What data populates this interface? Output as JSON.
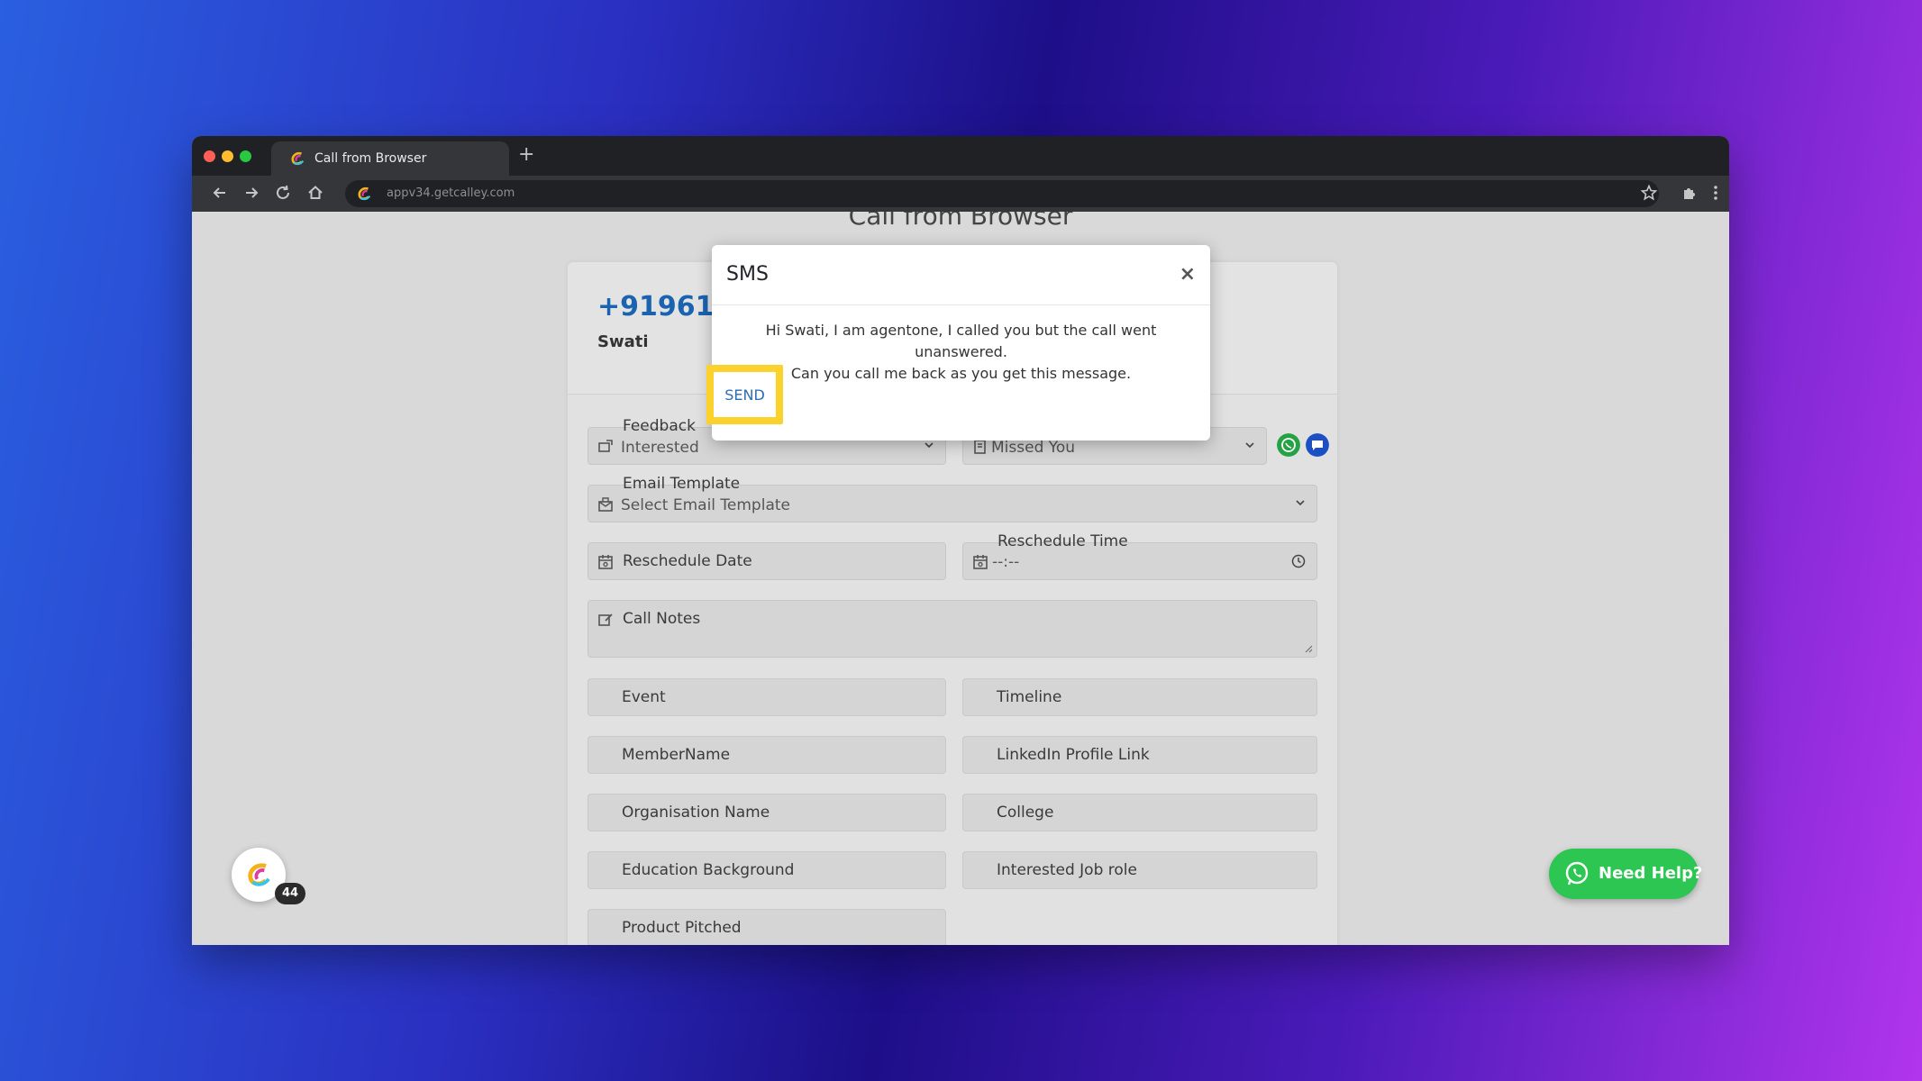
{
  "browser": {
    "tab_title": "Call from Browser",
    "new_tab_symbol": "+",
    "url": "appv34.getcalley.com"
  },
  "page": {
    "heading": "Call from Browser",
    "contact": {
      "phone": "+919611",
      "name": "Swati"
    },
    "fields": {
      "feedback_label": "Feedback",
      "feedback_value": "Interested",
      "message_template_value": "Missed You",
      "email_template_label": "Email Template",
      "email_template_value": "Select Email Template",
      "reschedule_date_label": "Reschedule Date",
      "reschedule_time_label": "Reschedule Time",
      "reschedule_time_value": "--:--",
      "call_notes_label": "Call Notes",
      "event_label": "Event",
      "timeline_label": "Timeline",
      "member_name_label": "MemberName",
      "linkedin_label": "LinkedIn Profile Link",
      "organisation_label": "Organisation Name",
      "college_label": "College",
      "education_label": "Education Background",
      "job_role_label": "Interested Job role",
      "product_pitched_label": "Product Pitched"
    },
    "fab_badge": "44",
    "need_help_label": "Need Help?"
  },
  "modal": {
    "title": "SMS",
    "close_symbol": "×",
    "message_line1": "Hi Swati, I am agentone, I called you but the call went unanswered.",
    "message_line2": "Can you call me back as you get this message.",
    "send_label": "SEND"
  },
  "colors": {
    "accent_blue": "#1a63b0",
    "whatsapp_green": "#2dc653",
    "highlight_yellow": "#fbd12c"
  }
}
